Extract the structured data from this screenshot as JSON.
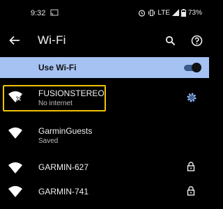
{
  "status_bar": {
    "time": "9:32",
    "network_type": "LTE",
    "battery": "73%",
    "icons": [
      "cast-icon",
      "alarm-icon",
      "vibrate-icon",
      "lte-signal-icon",
      "battery-icon"
    ]
  },
  "toolbar": {
    "title": "Wi-Fi",
    "icons": [
      "back-arrow-icon",
      "search-icon",
      "help-icon"
    ]
  },
  "use_wifi": {
    "label": "Use Wi-Fi",
    "enabled": true
  },
  "networks": [
    {
      "name": "FUSIONSTEREO",
      "status": "No internet",
      "icon": "wifi-no-internet-icon",
      "secured": false,
      "connected": true,
      "highlighted": true,
      "highlight_color": "#f0c400"
    },
    {
      "name": "GarminGuests",
      "status": "Saved",
      "icon": "wifi-icon",
      "secured": false
    },
    {
      "name": "GARMIN-627",
      "status": "",
      "icon": "wifi-icon",
      "secured": true
    },
    {
      "name": "GARMIN-741",
      "status": "",
      "icon": "wifi-icon",
      "secured": true
    }
  ],
  "colors": {
    "background": "#000000",
    "use_wifi_bar": "#a5c2f2",
    "accent": "#8ab4f8",
    "highlight": "#f0c400"
  }
}
